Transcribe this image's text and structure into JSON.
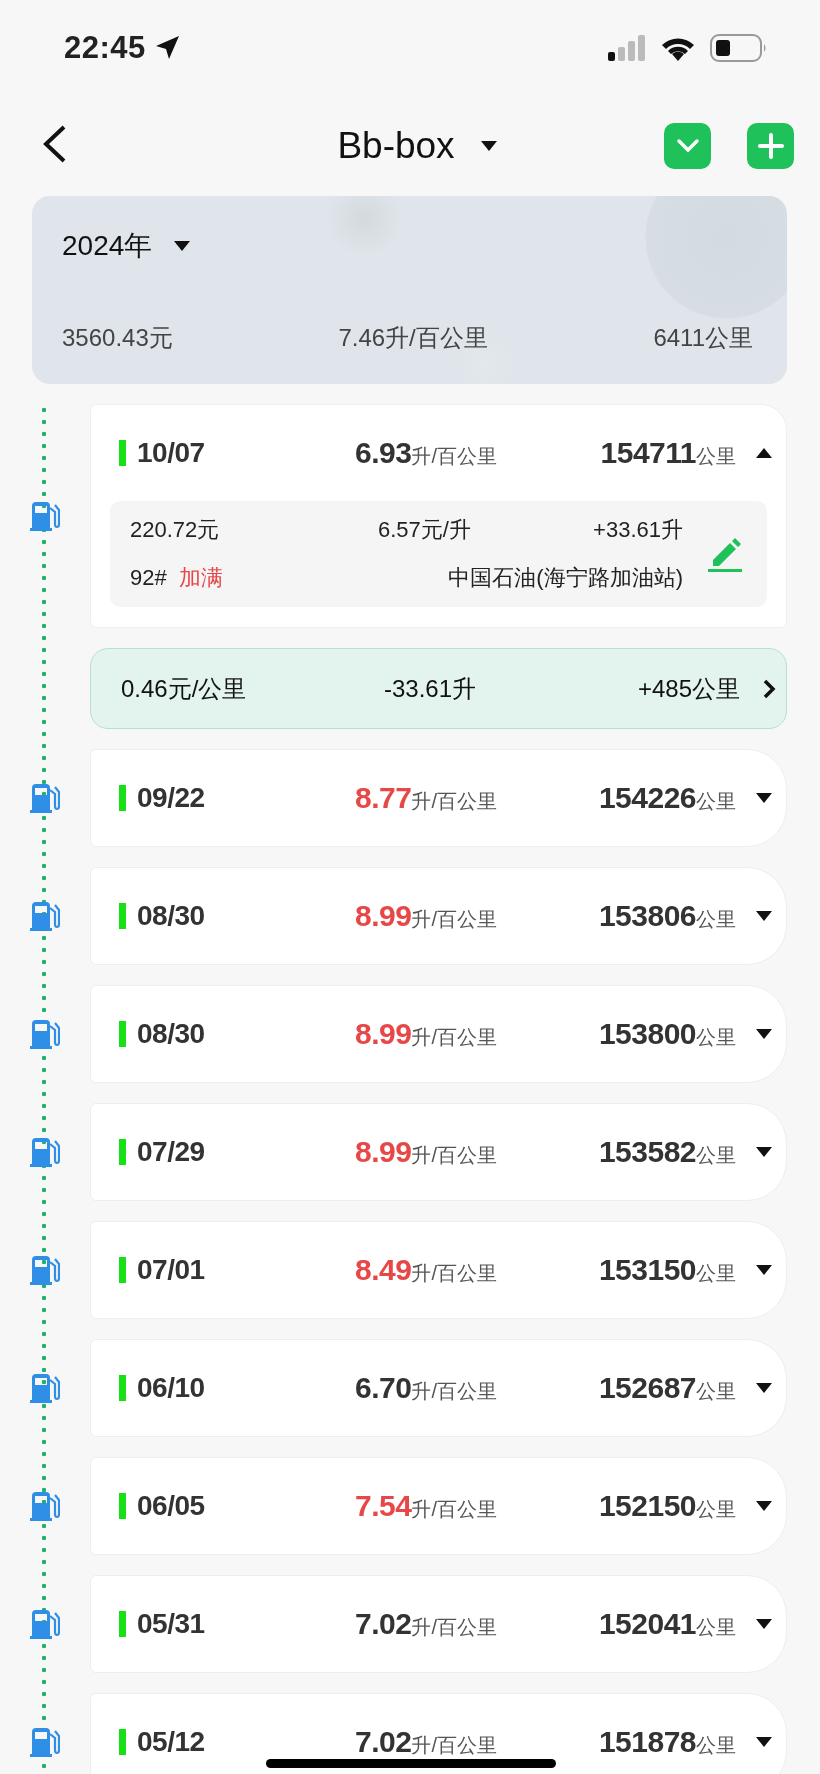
{
  "status_bar": {
    "time": "22:45"
  },
  "nav": {
    "title": "Bb-box"
  },
  "summary": {
    "year": "2024年",
    "cost": "3560.43元",
    "consumption": "7.46升/百公里",
    "distance": "6411公里"
  },
  "timeline": [
    {
      "kind": "refuel",
      "date": "10/07",
      "consumption": "6.93",
      "consumption_unit": "升/百公里",
      "odometer": "154711",
      "odometer_unit": "公里",
      "high": false,
      "expanded": true,
      "details": {
        "amount": "220.72元",
        "price": "6.57元/升",
        "volume": "+33.61升",
        "fuel_grade": "92#",
        "fill_type": "加满",
        "station": "中国石油(海宁路加油站)"
      }
    },
    {
      "kind": "interval",
      "cost_per_km": "0.46元/公里",
      "fuel_delta": "-33.61升",
      "distance_delta": "+485公里"
    },
    {
      "kind": "refuel",
      "date": "09/22",
      "consumption": "8.77",
      "consumption_unit": "升/百公里",
      "odometer": "154226",
      "odometer_unit": "公里",
      "high": true,
      "expanded": false
    },
    {
      "kind": "refuel",
      "date": "08/30",
      "consumption": "8.99",
      "consumption_unit": "升/百公里",
      "odometer": "153806",
      "odometer_unit": "公里",
      "high": true,
      "expanded": false
    },
    {
      "kind": "refuel",
      "date": "08/30",
      "consumption": "8.99",
      "consumption_unit": "升/百公里",
      "odometer": "153800",
      "odometer_unit": "公里",
      "high": true,
      "expanded": false
    },
    {
      "kind": "refuel",
      "date": "07/29",
      "consumption": "8.99",
      "consumption_unit": "升/百公里",
      "odometer": "153582",
      "odometer_unit": "公里",
      "high": true,
      "expanded": false
    },
    {
      "kind": "refuel",
      "date": "07/01",
      "consumption": "8.49",
      "consumption_unit": "升/百公里",
      "odometer": "153150",
      "odometer_unit": "公里",
      "high": true,
      "expanded": false
    },
    {
      "kind": "refuel",
      "date": "06/10",
      "consumption": "6.70",
      "consumption_unit": "升/百公里",
      "odometer": "152687",
      "odometer_unit": "公里",
      "high": false,
      "expanded": false
    },
    {
      "kind": "refuel",
      "date": "06/05",
      "consumption": "7.54",
      "consumption_unit": "升/百公里",
      "odometer": "152150",
      "odometer_unit": "公里",
      "high": true,
      "expanded": false
    },
    {
      "kind": "refuel",
      "date": "05/31",
      "consumption": "7.02",
      "consumption_unit": "升/百公里",
      "odometer": "152041",
      "odometer_unit": "公里",
      "high": false,
      "expanded": false
    },
    {
      "kind": "refuel",
      "date": "05/12",
      "consumption": "7.02",
      "consumption_unit": "升/百公里",
      "odometer": "151878",
      "odometer_unit": "公里",
      "high": false,
      "expanded": false
    }
  ]
}
